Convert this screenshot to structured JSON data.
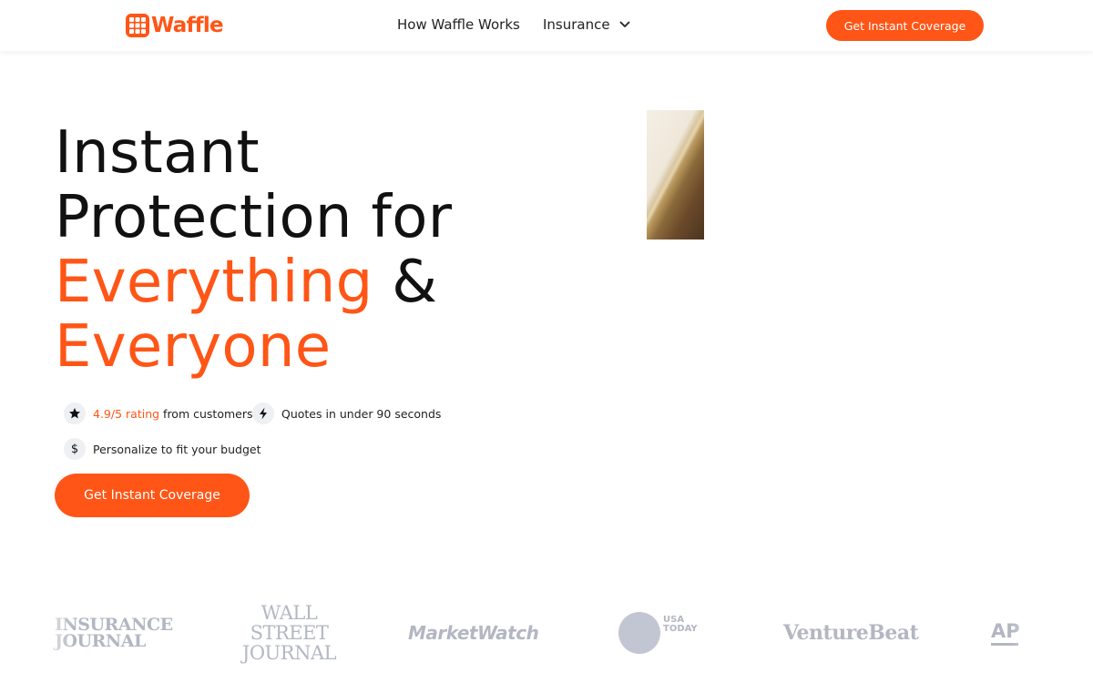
{
  "header": {
    "logo_text": "Waffle",
    "nav": {
      "how_it_works": "How Waffle Works",
      "insurance": "Insurance"
    },
    "cta": "Get Instant Coverage"
  },
  "hero": {
    "title_line1": "Instant",
    "title_line2": "Protection for",
    "title_accent1": "Everything",
    "title_amp": "&",
    "title_accent2": "Everyone",
    "features": {
      "rating_value": "4.9/5 rating",
      "rating_suffix": "from customers",
      "quotes": "Quotes in under 90 seconds",
      "budget": "Personalize to fit your budget"
    },
    "cta": "Get Instant Coverage"
  },
  "press": {
    "insurance_journal": [
      "INSURANCE",
      "JOURNAL"
    ],
    "wsj": [
      "WALL STREET",
      "JOURNAL"
    ],
    "marketwatch": "MarketWatch",
    "usa_today": [
      "USA",
      "TODAY"
    ],
    "venturebeat": "VentureBeat",
    "ap": "AP"
  },
  "icons": {
    "logo": "waffle-logo-icon",
    "insurance_dropdown": "chevron-down-icon",
    "rating": "star-icon",
    "quotes": "lightning-icon",
    "budget": "dollar-icon"
  },
  "colors": {
    "brand": "#ff5516",
    "text": "#111111",
    "press_logo": "#b3b7c2"
  }
}
